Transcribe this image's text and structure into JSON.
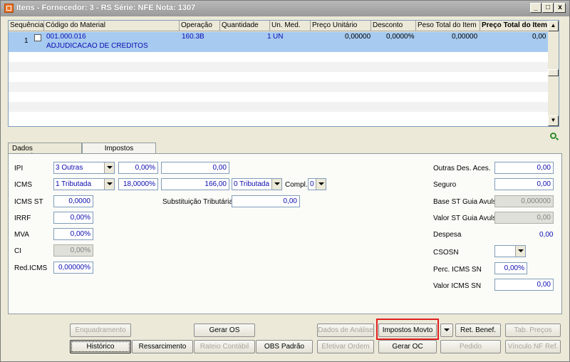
{
  "window": {
    "title": "Itens - Fornecedor: 3 - RS Série: NFE  Nota: 1307",
    "minimize": "_",
    "maximize": "□",
    "close": "x"
  },
  "grid": {
    "columns": [
      "Sequência",
      "Código do Material",
      "Operação",
      "Quantidade",
      "Un. Med.",
      "Preço Unitário",
      "Desconto",
      "Peso Total do Item",
      "Preço Total do Item"
    ],
    "row": {
      "sequencia": "1",
      "codigo": "001.000.016",
      "descricao": "ADJUDICACAO DE CREDITOS",
      "operacao": "160.3B",
      "quantidade": "1",
      "un_med": "UN",
      "preco_unitario": "0,00000",
      "desconto": "0,0000%",
      "peso_total": "0,00000",
      "preco_total": "0,00"
    }
  },
  "tabs": [
    "Dados Complementares",
    "Impostos"
  ],
  "impostos": {
    "ipi": {
      "label": "IPI",
      "select": "3 Outras",
      "percent": "0,00%",
      "value": "0,00"
    },
    "icms": {
      "label": "ICMS",
      "select": "1 Tributada",
      "percent": "18,0000%",
      "value": "166,00",
      "select2": "0 Tributada",
      "compl_label": "Compl.",
      "compl": "0"
    },
    "icms_st": {
      "label": "ICMS ST",
      "value": "0,0000"
    },
    "subst": {
      "label": "Substituição Tributária",
      "value": "0,00"
    },
    "irrf": {
      "label": "IRRF",
      "value": "0,00%"
    },
    "mva": {
      "label": "MVA",
      "value": "0,00%"
    },
    "ci": {
      "label": "CI",
      "value": "0,00%"
    },
    "red_icms": {
      "label": "Red.ICMS",
      "value": "0,00000%"
    },
    "outras": {
      "label": "Outras Des. Aces.",
      "value": "0,00"
    },
    "seguro": {
      "label": "Seguro",
      "value": "0,00"
    },
    "base_st": {
      "label": "Base ST Guia Avulsa",
      "value": "0,000000"
    },
    "valor_st": {
      "label": "Valor ST Guia Avulsa",
      "value": "0,00"
    },
    "despesa": {
      "label": "Despesa",
      "value": "0,00"
    },
    "csosn": {
      "label": "CSOSN",
      "value": ""
    },
    "perc_sn": {
      "label": "Perc. ICMS SN",
      "value": "0,00%"
    },
    "valor_sn": {
      "label": "Valor ICMS SN",
      "value": "0,00"
    }
  },
  "buttons": {
    "enquadramento": "Enquadramento",
    "gerar_os": "Gerar OS",
    "dados_analise": "Dados de Análise",
    "impostos_movto": "Impostos Movto",
    "ret_benef": "Ret. Benef.",
    "tab_precos": "Tab. Preços",
    "historico": "Histórico",
    "ressarcimento": "Ressarcimento",
    "rateio": "Rateio Contábil",
    "obs_padrao": "OBS Padrão",
    "efetivar_ordem": "Efetivar Ordem",
    "gerar_oc": "Gerar OC",
    "pedido": "Pedido",
    "vinculo_nf": "Vínculo NF Ref."
  }
}
